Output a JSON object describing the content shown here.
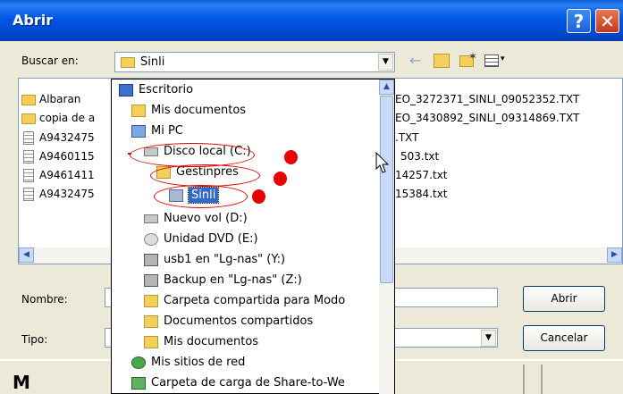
{
  "window": {
    "title": "Abrir"
  },
  "toolbar": {
    "look_in_label": "Buscar en:",
    "look_in_value": "Sinli"
  },
  "files": [
    {
      "name": "Albaran",
      "type": "folder"
    },
    {
      "name": "copia de a",
      "type": "folder"
    },
    {
      "name": "A9432475",
      "type": "file"
    },
    {
      "name": "A9460115",
      "type": "file"
    },
    {
      "name": "A9461411",
      "type": "file"
    },
    {
      "name": "A9432475",
      "type": "file"
    }
  ],
  "files_right": [
    "EO_3272371_SINLI_09052352.TXT",
    "EO_3430892_SINLI_09314869.TXT",
    ".TXT",
    "503.txt",
    "14257.txt",
    "15384.txt"
  ],
  "form": {
    "name_label": "Nombre:",
    "type_label": "Tipo:"
  },
  "buttons": {
    "open": "Abrir",
    "cancel": "Cancelar"
  },
  "bottom_partial_text": "M",
  "dropdown": {
    "items": [
      {
        "label": "Escritorio",
        "icon": "desktop-icon"
      },
      {
        "label": "Mis documentos",
        "icon": "my-documents-icon"
      },
      {
        "label": "Mi PC",
        "icon": "my-computer-icon"
      },
      {
        "label": "Disco local (C:)",
        "icon": "hard-disk-icon"
      },
      {
        "label": "Gestinpres",
        "icon": "folder-icon"
      },
      {
        "label": "Sinli",
        "icon": "folder-open-icon",
        "selected": true
      },
      {
        "label": "Nuevo vol (D:)",
        "icon": "hard-disk-icon"
      },
      {
        "label": "Unidad DVD (E:)",
        "icon": "dvd-drive-icon"
      },
      {
        "label": "usb1 en \"Lg-nas\" (Y:)",
        "icon": "network-drive-icon"
      },
      {
        "label": "Backup en \"Lg-nas\" (Z:)",
        "icon": "network-drive-icon"
      },
      {
        "label": "Carpeta compartida para Modo",
        "icon": "shared-folder-icon"
      },
      {
        "label": "Documentos compartidos",
        "icon": "folder-icon"
      },
      {
        "label": "Mis documentos",
        "icon": "folder-icon"
      },
      {
        "label": "Mis sitios de red",
        "icon": "network-places-icon"
      },
      {
        "label": "Carpeta de carga de Share-to-We",
        "icon": "upload-folder-icon"
      }
    ]
  },
  "colors": {
    "titlebar": "#0055e5",
    "dialog_bg": "#ece9d8",
    "selection": "#316ac5",
    "annotation": "#e00000"
  }
}
